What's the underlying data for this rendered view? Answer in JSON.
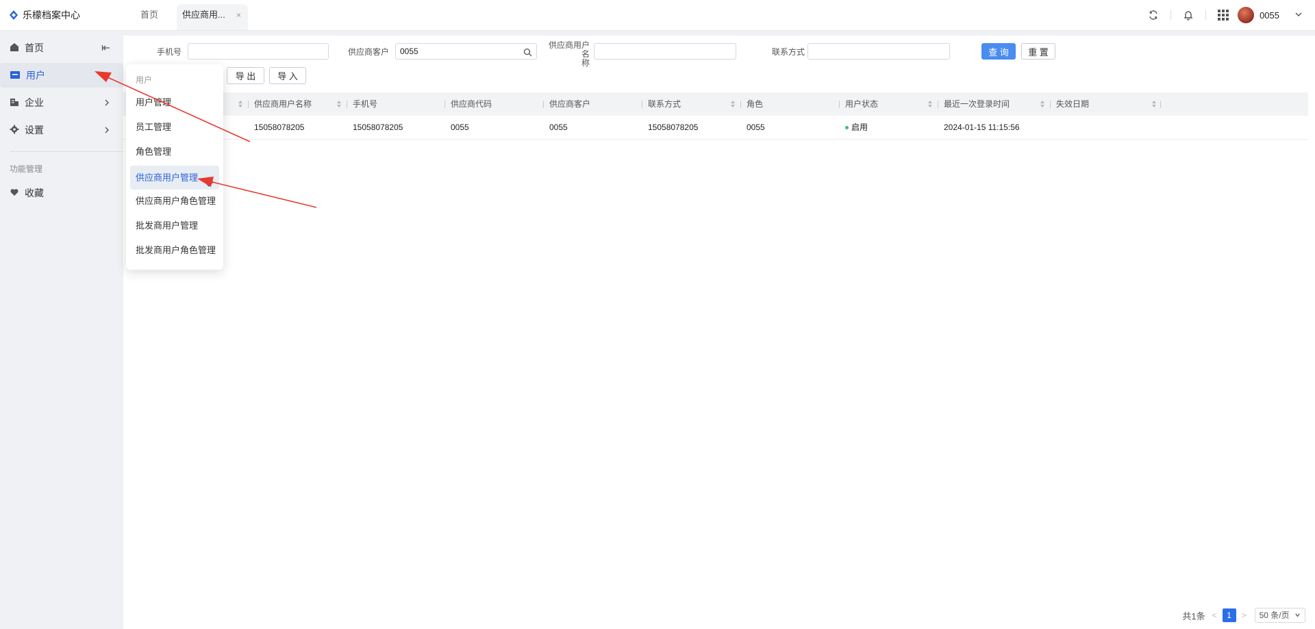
{
  "app": {
    "title": "乐檬档案中心"
  },
  "tabs": [
    {
      "label": "首页"
    },
    {
      "label": "供应商用...",
      "close": "×"
    }
  ],
  "header": {
    "username": "0055"
  },
  "sidebar": {
    "items": [
      {
        "label": "首页",
        "icon": "home-icon"
      },
      {
        "label": "用户",
        "icon": "user-folder-icon",
        "active": true
      },
      {
        "label": "企业",
        "icon": "building-icon"
      },
      {
        "label": "设置",
        "icon": "gear-icon"
      }
    ],
    "section_title": "功能管理",
    "favorites": {
      "label": "收藏",
      "icon": "heart-icon"
    }
  },
  "filters": {
    "phone_label": "手机号",
    "phone_value": "",
    "supplier_customer_label": "供应商客户",
    "supplier_customer_value": "0055",
    "supplier_user_name_label_line1": "供应商用户名",
    "supplier_user_name_label_line2": "称",
    "supplier_user_name_value": "",
    "contact_label": "联系方式",
    "contact_value": "",
    "query_button": "查 询",
    "reset_button": "重 置"
  },
  "toolbar": {
    "export_button": "导 出",
    "import_button": "导 入"
  },
  "table": {
    "columns": [
      "供应商用户名称",
      "手机号",
      "供应商代码",
      "供应商客户",
      "联系方式",
      "角色",
      "用户状态",
      "最近一次登录时间",
      "失效日期"
    ],
    "rows": [
      {
        "supplier_user_name": "15058078205",
        "phone": "15058078205",
        "supplier_code": "0055",
        "supplier_customer": "0055",
        "contact": "15058078205",
        "role": "0055",
        "status": "启用",
        "last_login": "2024-01-15 11:15:56",
        "expire_date": ""
      }
    ]
  },
  "pagination": {
    "total": "共1条",
    "current_page": "1",
    "page_size": "50 条/页"
  },
  "dropdown_menu": {
    "header": "用户",
    "items": [
      {
        "label": "用户管理"
      },
      {
        "label": "员工管理"
      },
      {
        "label": "角色管理"
      },
      {
        "label": "供应商用户管理",
        "active": true
      },
      {
        "label": "供应商用户角色管理"
      },
      {
        "label": "批发商用户管理"
      },
      {
        "label": "批发商用户角色管理"
      }
    ]
  },
  "colors": {
    "accent": "#2a62d9",
    "primary_button": "#4a8cf0",
    "annotation_arrow": "#e8392c",
    "status_enabled": "#3fbf6f"
  }
}
